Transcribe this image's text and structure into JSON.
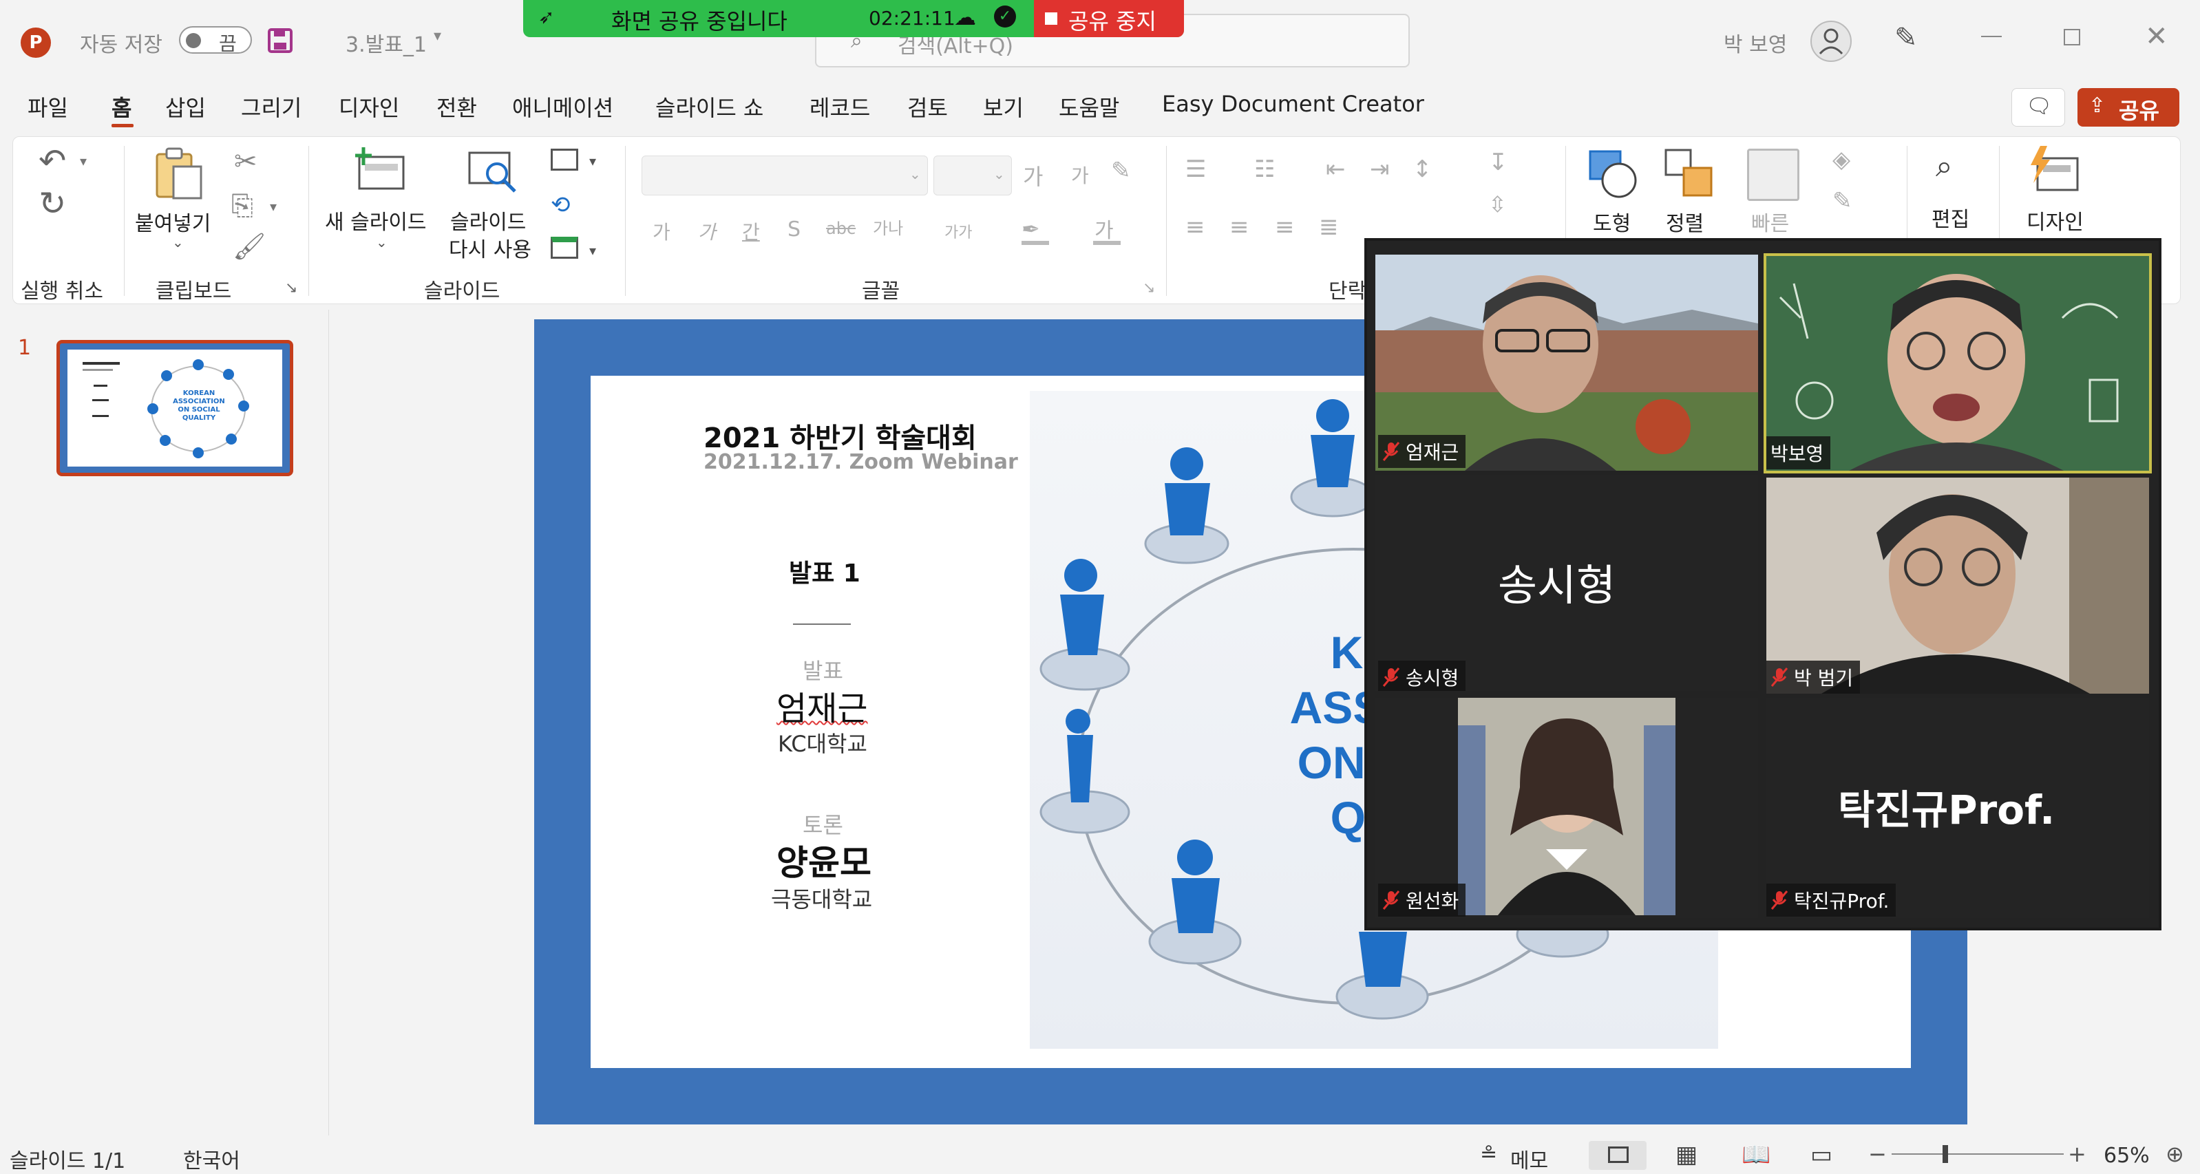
{
  "titlebar": {
    "autosave_label": "자동 저장",
    "autosave_state": "끔",
    "filename": "3.발표_1",
    "search_placeholder": "검색(Alt+Q)",
    "user_name": "박 보영"
  },
  "share_banner": {
    "text": "화면 공유 중입니다",
    "timer": "02:21:11",
    "stop_label": "공유 중지"
  },
  "tabs": [
    "파일",
    "홈",
    "삽입",
    "그리기",
    "디자인",
    "전환",
    "애니메이션",
    "슬라이드 쇼",
    "레코드",
    "검토",
    "보기",
    "도움말",
    "Easy Document Creator"
  ],
  "share_button": "공유",
  "ribbon": {
    "undo_group": "실행 취소",
    "clipboard_group": "클립보드",
    "paste": "붙여넣기",
    "slides_group": "슬라이드",
    "new_slide": "새 슬라이드",
    "reuse_slide_line1": "슬라이드",
    "reuse_slide_line2": "다시 사용",
    "font_group": "글꼴",
    "paragraph_group": "단락",
    "shapes": "도형",
    "arrange": "정렬",
    "quick_styles": "빠른",
    "editing": "편집",
    "designer": "디자인",
    "font_buttons": [
      "가",
      "가",
      "간",
      "S",
      "가나",
      "가나",
      "가가"
    ],
    "font_size_up": "가",
    "font_size_down": "가"
  },
  "thumbnail": {
    "number": "1",
    "line1": "KOREAN",
    "line2": "ASSOCIATION",
    "line3": "ON SOCIAL",
    "line4": "QUALITY"
  },
  "slide": {
    "title": "2021 하반기 학술대회",
    "subtitle": "2021.12.17. Zoom Webinar",
    "session": "발표 1",
    "presenter_role": "발표",
    "presenter_name": "엄재근",
    "presenter_affil": "KC대학교",
    "discussant_role": "토론",
    "discussant_name": "양윤모",
    "discussant_affil": "극동대학교",
    "logo_line1": "KOR",
    "logo_line2": "ASSOC",
    "logo_line3": "ON SO",
    "logo_line4": "QUA"
  },
  "participants": [
    {
      "name": "엄재근",
      "video": true
    },
    {
      "name": "박보영",
      "video": true,
      "speaking": true
    },
    {
      "name": "송시형",
      "video": false,
      "display": "송시형"
    },
    {
      "name": "박 범기",
      "video": true
    },
    {
      "name": "원선화",
      "video": true
    },
    {
      "name": "탁진규Prof.",
      "video": false,
      "display": "탁진규Prof."
    }
  ],
  "statusbar": {
    "slide_counter": "슬라이드 1/1",
    "language": "한국어",
    "notes": "메모",
    "zoom": "65%"
  },
  "colors": {
    "accent": "#c43e1c",
    "banner_green": "#2ebd4b",
    "stop_red": "#e0332f",
    "slide_blue": "#3d73b9",
    "figure_blue": "#1f6fc6"
  }
}
